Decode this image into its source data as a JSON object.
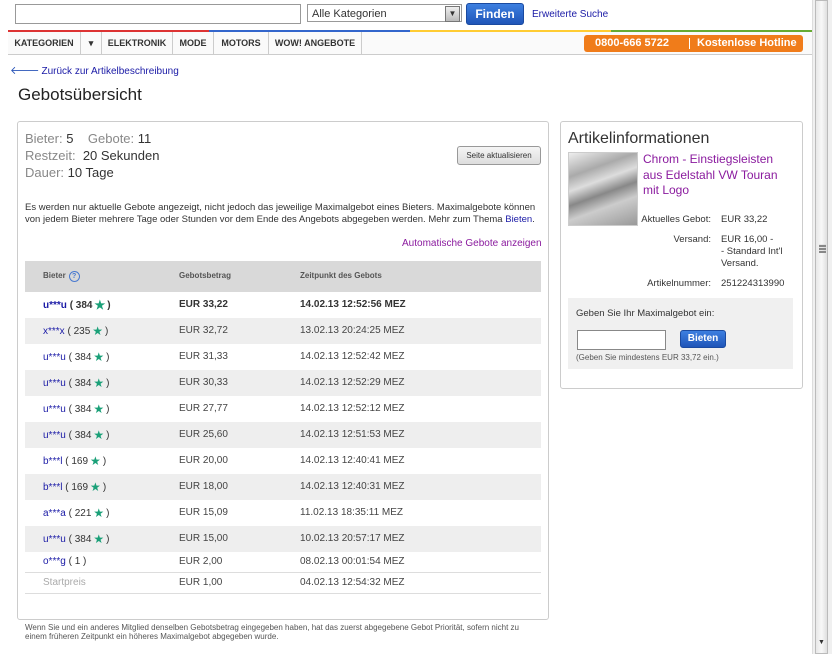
{
  "header": {
    "search_placeholder": "",
    "category_value": "Alle Kategorien",
    "find_label": "Finden",
    "advanced_search_label": "Erweiterte Suche"
  },
  "nav": {
    "items": [
      "KATEGORIEN",
      "ELEKTRONIK",
      "MODE",
      "MOTORS",
      "WOW! ANGEBOTE"
    ],
    "hotline_number": "0800-666 5722",
    "hotline_label": "Kostenlose Hotline"
  },
  "page": {
    "back_link": "Zurück zur Artikelbeschreibung",
    "title": "Gebotsübersicht"
  },
  "summary": {
    "bidders_label": "Bieter:",
    "bidders_value": "5",
    "bids_label": "Gebote:",
    "bids_value": "11",
    "remaining_label": "Restzeit:",
    "remaining_value": "20 Sekunden",
    "duration_label": "Dauer:",
    "duration_value": "10 Tage",
    "refresh_label": "Seite aktualisieren",
    "info_text": "Es werden nur aktuelle Gebote angezeigt, nicht jedoch das jeweilige Maximalgebot eines Bieters. Maximalgebote können von jedem Bieter mehrere Tage oder Stunden vor dem Ende des Angebots abgegeben werden. Mehr zum Thema",
    "info_link": "Bieten",
    "info_end": ".",
    "auto_bids_link": "Automatische Gebote anzeigen"
  },
  "table": {
    "headers": {
      "bidder": "Bieter",
      "help": "?",
      "amount": "Gebotsbetrag",
      "time": "Zeitpunkt des Gebots"
    },
    "rows": [
      {
        "bidder": "u***u",
        "score": "( 384",
        "close": ")",
        "star": true,
        "amount": "EUR 33,22",
        "time": "14.02.13 12:52:56 MEZ"
      },
      {
        "bidder": "x***x",
        "score": "( 235",
        "close": ")",
        "star": true,
        "amount": "EUR 32,72",
        "time": "13.02.13 20:24:25 MEZ"
      },
      {
        "bidder": "u***u",
        "score": "( 384",
        "close": ")",
        "star": true,
        "amount": "EUR 31,33",
        "time": "14.02.13 12:52:42 MEZ"
      },
      {
        "bidder": "u***u",
        "score": "( 384",
        "close": ")",
        "star": true,
        "amount": "EUR 30,33",
        "time": "14.02.13 12:52:29 MEZ"
      },
      {
        "bidder": "u***u",
        "score": "( 384",
        "close": ")",
        "star": true,
        "amount": "EUR 27,77",
        "time": "14.02.13 12:52:12 MEZ"
      },
      {
        "bidder": "u***u",
        "score": "( 384",
        "close": ")",
        "star": true,
        "amount": "EUR 25,60",
        "time": "14.02.13 12:51:53 MEZ"
      },
      {
        "bidder": "b***l",
        "score": "( 169",
        "close": ")",
        "star": true,
        "amount": "EUR 20,00",
        "time": "14.02.13 12:40:41 MEZ"
      },
      {
        "bidder": "b***l",
        "score": "( 169",
        "close": ")",
        "star": true,
        "amount": "EUR 18,00",
        "time": "14.02.13 12:40:31 MEZ"
      },
      {
        "bidder": "a***a",
        "score": "( 221",
        "close": ")",
        "star": true,
        "amount": "EUR 15,09",
        "time": "11.02.13 18:35:11 MEZ"
      },
      {
        "bidder": "u***u",
        "score": "( 384",
        "close": ")",
        "star": true,
        "amount": "EUR 15,00",
        "time": "10.02.13 20:57:17 MEZ"
      },
      {
        "bidder": "o***g",
        "score": "( 1 )",
        "close": "",
        "star": false,
        "amount": "EUR 2,00",
        "time": "08.02.13 00:01:54 MEZ"
      },
      {
        "bidder": "Startpreis",
        "score": "",
        "close": "",
        "star": false,
        "amount": "EUR 1,00",
        "time": "04.02.13 12:54:32 MEZ"
      }
    ]
  },
  "footer_note": "Wenn Sie und ein anderes Mitglied denselben Gebotsbetrag eingegeben haben, hat das zuerst abgegebene Gebot Priorität, sofern nicht zu einem früheren Zeitpunkt ein höheres Maximalgebot abgegeben wurde.",
  "item": {
    "section_title": "Artikelinformationen",
    "title": "Chrom - Einstiegsleisten aus Edelstahl VW Touran mit Logo",
    "current_bid_label": "Aktuelles Gebot:",
    "current_bid_value": "EUR 33,22",
    "shipping_label": "Versand:",
    "shipping_value": "EUR 16,00 -",
    "shipping_detail1": "- Standard Int'l",
    "shipping_detail2": "Versand.",
    "item_number_label": "Artikelnummer:",
    "item_number_value": "251224313990",
    "max_bid_label": "Geben Sie Ihr Maximalgebot ein:",
    "bid_button": "Bieten",
    "bid_hint": "(Geben Sie mindestens EUR 33,72 ein.)"
  },
  "colors": {
    "link": "#1a1aa6",
    "item_title": "#8a1a9e",
    "hotline": "#f07c1a",
    "button": "#2a62c8",
    "star": "#1aa078"
  }
}
